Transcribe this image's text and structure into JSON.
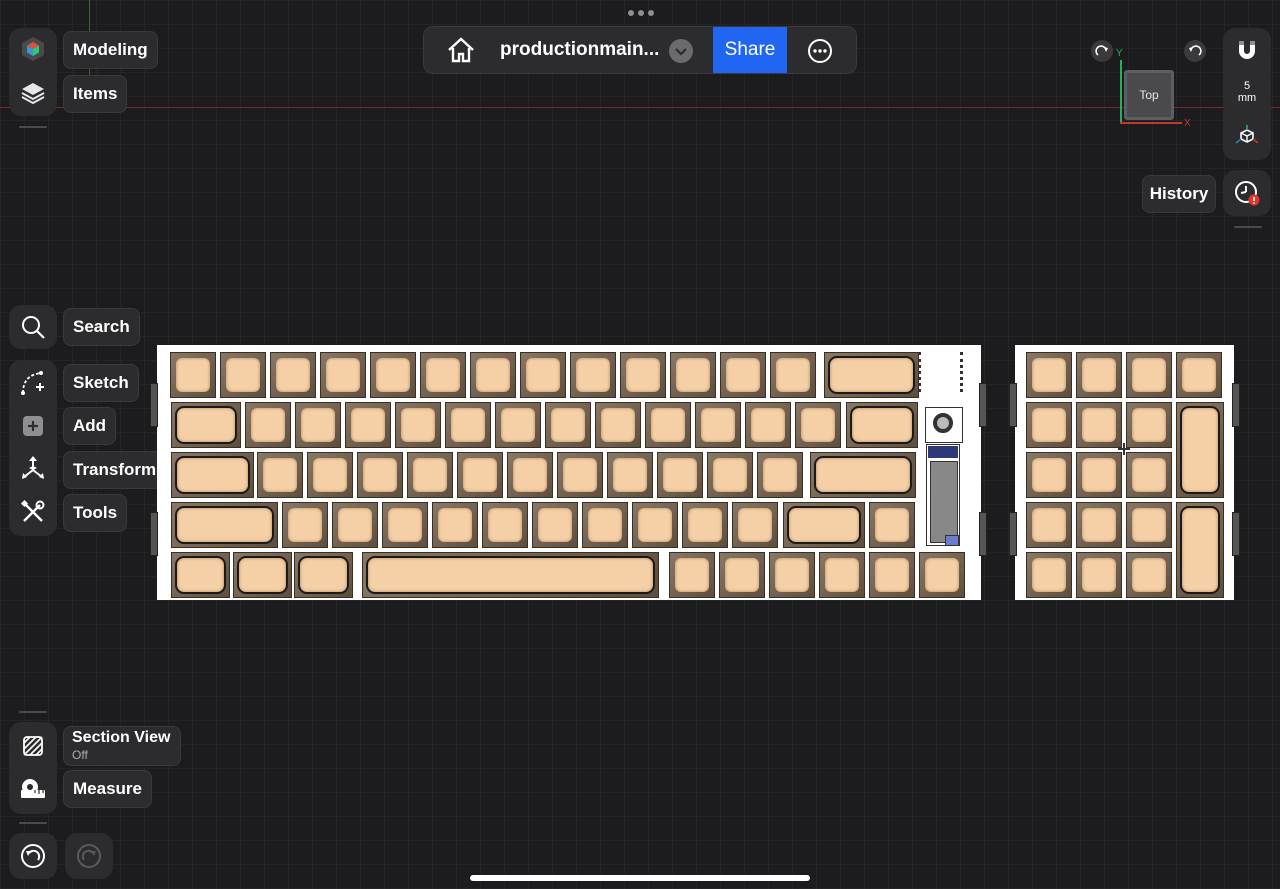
{
  "app": {
    "doc_title": "productionmain...",
    "share_label": "Share"
  },
  "left_toolbar": {
    "modeling_label": "Modeling",
    "items_label": "Items",
    "search_label": "Search",
    "sketch_label": "Sketch",
    "add_label": "Add",
    "transform_label": "Transform",
    "tools_label": "Tools",
    "section_view_label": "Section View",
    "section_view_state": "Off",
    "measure_label": "Measure"
  },
  "right_toolbar": {
    "grid_size_value": "5",
    "grid_size_unit": "mm",
    "history_label": "History"
  },
  "view_cube": {
    "face_label": "Top",
    "axis_x": "X",
    "axis_y": "Y"
  },
  "icons": [
    "home-icon",
    "chevron-down-icon",
    "more-icon",
    "modeling-icon",
    "layers-icon",
    "search-icon",
    "sketch-icon",
    "add-icon",
    "transform-icon",
    "tools-icon",
    "section-view-icon",
    "measure-icon",
    "undo-icon",
    "redo-icon",
    "magnet-icon",
    "axes-icon",
    "history-clock-icon",
    "rotate-cw-icon",
    "rotate-ccw-icon"
  ],
  "colors": {
    "share_blue": "#2166f3",
    "keycap": "#f5cfa6",
    "alert_red": "#e5342a"
  }
}
